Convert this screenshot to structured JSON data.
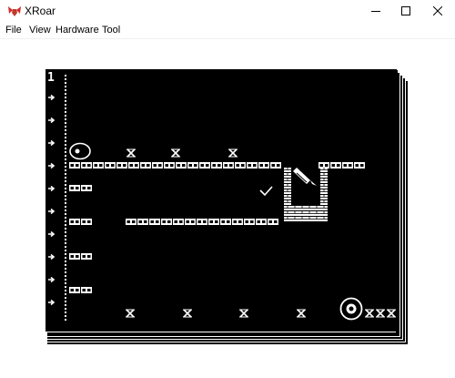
{
  "window": {
    "title": "XRoar",
    "minimize_icon": "minimize-icon",
    "maximize_icon": "maximize-icon",
    "close_icon": "close-icon"
  },
  "menu": {
    "items": [
      {
        "label": "File"
      },
      {
        "label": "View"
      },
      {
        "label": "Hardware"
      },
      {
        "label": "Tool"
      }
    ]
  },
  "game": {
    "level_number": "1",
    "colors": {
      "background": "#000000",
      "foreground": "#ffffff",
      "window": "#ffffff"
    }
  }
}
